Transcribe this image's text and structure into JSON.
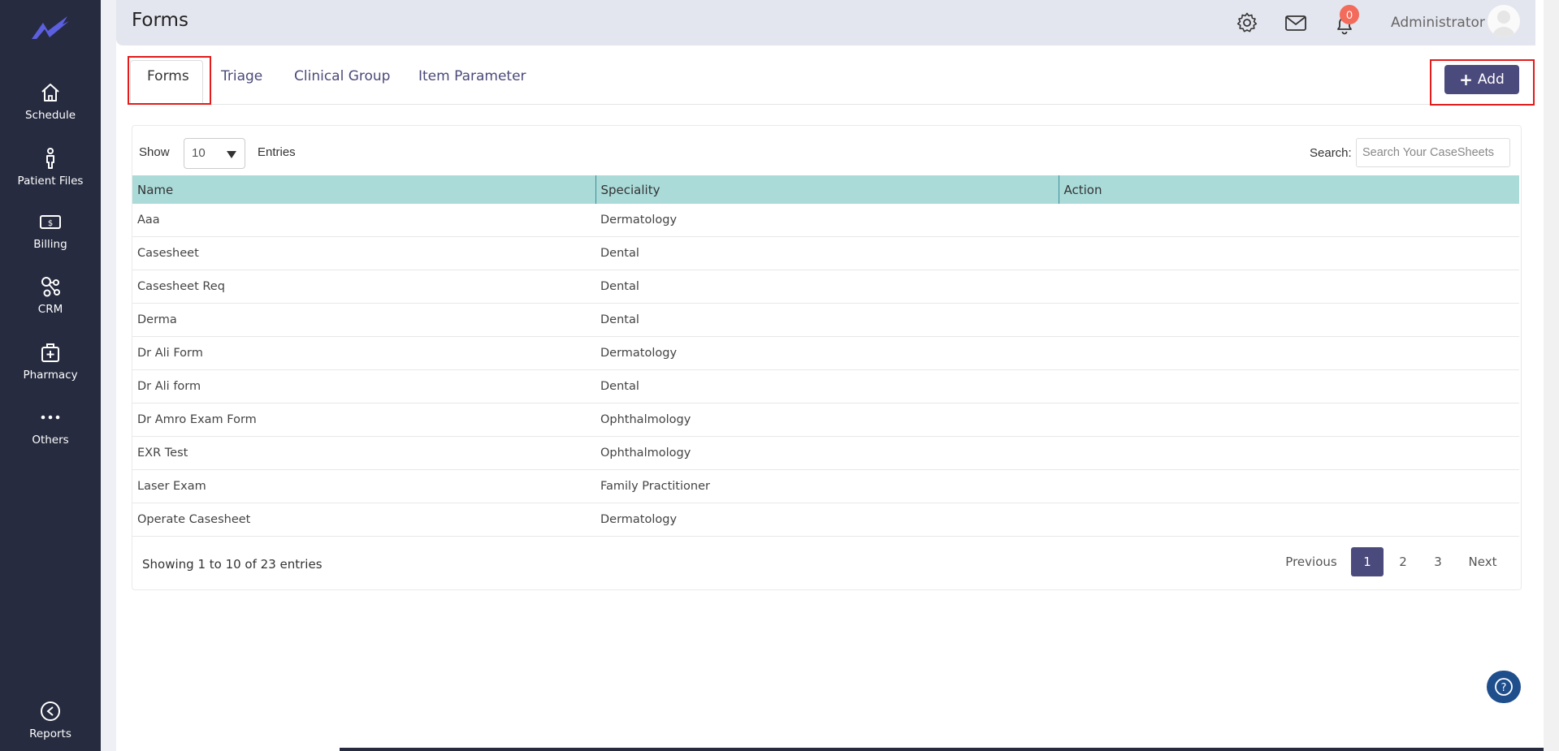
{
  "sidebar": {
    "items": [
      {
        "label": "Schedule",
        "icon": "home-icon"
      },
      {
        "label": "Patient Files",
        "icon": "person-icon"
      },
      {
        "label": "Billing",
        "icon": "money-icon"
      },
      {
        "label": "CRM",
        "icon": "network-icon"
      },
      {
        "label": "Pharmacy",
        "icon": "pharmacy-bag-icon"
      },
      {
        "label": "Others",
        "icon": "more-dots-icon"
      }
    ],
    "reports_label": "Reports"
  },
  "header": {
    "title": "Forms",
    "notification_count": "0",
    "user_name": "Administrator"
  },
  "tabs": [
    {
      "label": "Forms",
      "active": true
    },
    {
      "label": "Triage",
      "active": false
    },
    {
      "label": "Clinical Group",
      "active": false
    },
    {
      "label": "Item Parameter",
      "active": false
    }
  ],
  "toolbar": {
    "add_label": "Add"
  },
  "table_controls": {
    "show_label": "Show",
    "page_size": "10",
    "entries_label": "Entries",
    "search_label": "Search:",
    "search_placeholder": "Search Your CaseSheets"
  },
  "table": {
    "columns": [
      "Name",
      "Speciality",
      "Action"
    ],
    "rows": [
      {
        "name": "Aaa",
        "speciality": "Dermatology"
      },
      {
        "name": "Casesheet",
        "speciality": "Dental"
      },
      {
        "name": "Casesheet Req",
        "speciality": "Dental"
      },
      {
        "name": "Derma",
        "speciality": "Dental"
      },
      {
        "name": "Dr Ali Form",
        "speciality": "Dermatology"
      },
      {
        "name": "Dr Ali form",
        "speciality": "Dental"
      },
      {
        "name": "Dr Amro Exam Form",
        "speciality": "Ophthalmology"
      },
      {
        "name": "EXR Test",
        "speciality": "Ophthalmology"
      },
      {
        "name": "Laser Exam",
        "speciality": "Family Practitioner"
      },
      {
        "name": "Operate Casesheet",
        "speciality": "Dermatology"
      }
    ]
  },
  "pagination": {
    "summary": "Showing 1 to 10 of 23 entries",
    "previous": "Previous",
    "pages": [
      "1",
      "2",
      "3"
    ],
    "current": "1",
    "next": "Next"
  },
  "colors": {
    "sidebar_bg": "#262b3f",
    "accent": "#4b4a7c",
    "table_header": "#aadbd9",
    "badge": "#f26b5b",
    "highlight_border": "#e31b1b"
  }
}
